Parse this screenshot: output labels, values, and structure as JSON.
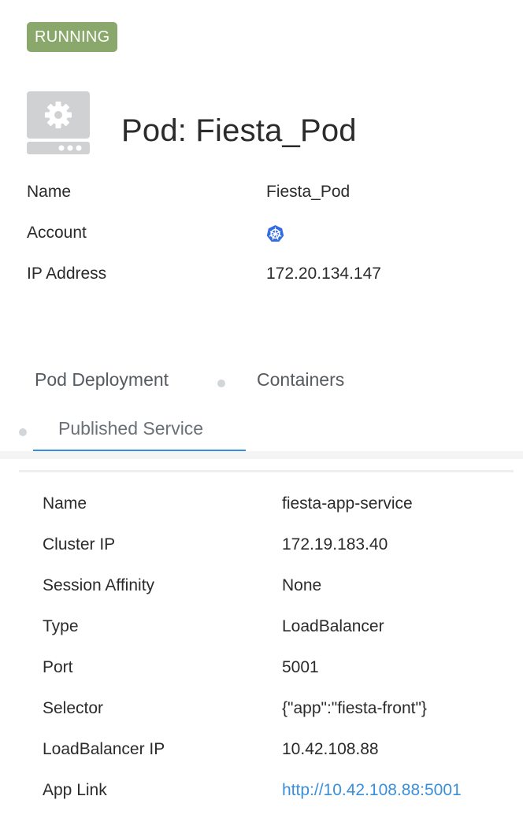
{
  "status": {
    "label": "RUNNING",
    "color": "#8aa86b"
  },
  "header": {
    "title": "Pod: Fiesta_Pod",
    "icon": "server-gear-icon"
  },
  "properties": [
    {
      "label": "Name",
      "value": "Fiesta_Pod"
    },
    {
      "label": "Account",
      "value": "",
      "icon": "kubernetes-icon"
    },
    {
      "label": "IP Address",
      "value": "172.20.134.147"
    }
  ],
  "tabs": [
    {
      "label": "Pod Deployment"
    },
    {
      "label": "Containers"
    },
    {
      "label": "Published Service",
      "active": true
    }
  ],
  "service": [
    {
      "label": "Name",
      "value": "fiesta-app-service"
    },
    {
      "label": "Cluster IP",
      "value": "172.19.183.40"
    },
    {
      "label": "Session Affinity",
      "value": "None"
    },
    {
      "label": "Type",
      "value": "LoadBalancer"
    },
    {
      "label": "Port",
      "value": "5001"
    },
    {
      "label": "Selector",
      "value": "{\"app\":\"fiesta-front\"}"
    },
    {
      "label": "LoadBalancer IP",
      "value": "10.42.108.88"
    },
    {
      "label": "App Link",
      "value": "http://10.42.108.88:5001",
      "link": true
    }
  ],
  "colors": {
    "accent": "#3a8fdc",
    "badge": "#8aa86b",
    "icon_gray": "#cfd1d3"
  }
}
